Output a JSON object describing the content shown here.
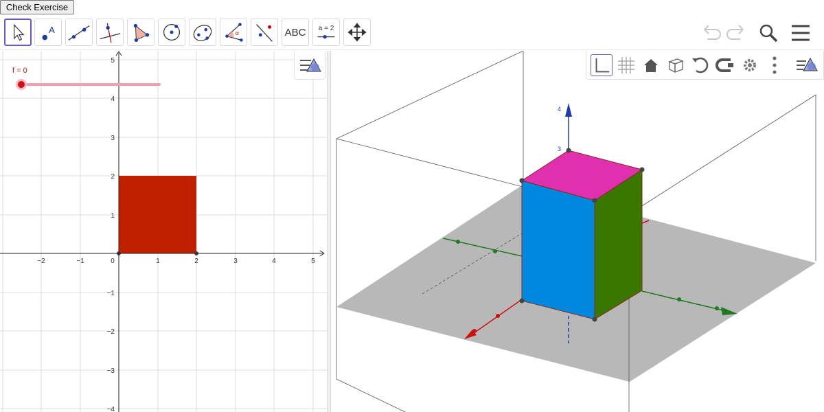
{
  "check_button": {
    "label": "Check Exercise"
  },
  "toolbar": {
    "tools": [
      {
        "name": "move-tool",
        "icon": "arrow-cursor-icon",
        "selected": true
      },
      {
        "name": "point-tool",
        "icon": "point-icon"
      },
      {
        "name": "line-tool",
        "icon": "line-icon"
      },
      {
        "name": "perpendicular-line-tool",
        "icon": "perpendicular-icon"
      },
      {
        "name": "polygon-tool",
        "icon": "polygon-icon"
      },
      {
        "name": "circle-tool",
        "icon": "circle-icon"
      },
      {
        "name": "ellipse-tool",
        "icon": "ellipse-icon"
      },
      {
        "name": "angle-tool",
        "icon": "angle-icon"
      },
      {
        "name": "reflect-tool",
        "icon": "reflect-icon"
      },
      {
        "name": "text-tool",
        "icon": "text-icon",
        "label": "ABC"
      },
      {
        "name": "slider-tool",
        "icon": "slider-icon",
        "label": "a = 2"
      },
      {
        "name": "move-view-tool",
        "icon": "move-arrows-icon"
      }
    ],
    "right": [
      "undo-icon",
      "redo-icon",
      "search-icon",
      "menu-icon"
    ]
  },
  "graphics2d": {
    "slider": {
      "label": "f = 0",
      "value": 0
    },
    "x_ticks": [
      "−2",
      "−1",
      "0",
      "1",
      "2",
      "3",
      "4",
      "5"
    ],
    "y_ticks": [
      "5",
      "4",
      "3",
      "2",
      "1",
      "−1",
      "−2",
      "−3",
      "−4"
    ],
    "square": {
      "color": "#c02000"
    }
  },
  "graphics3d": {
    "buttons": [
      "axes-icon",
      "grid-icon",
      "home-icon",
      "view-cube-icon",
      "rotate-icon",
      "projection-icon",
      "settings-icon",
      "more-icon",
      "style-bar-icon"
    ],
    "z_labels": [
      "4",
      "3"
    ],
    "colors": {
      "top": "#e030b0",
      "front": "#0088e0",
      "right": "#3a7700",
      "plane": "#b8b8b8"
    }
  }
}
